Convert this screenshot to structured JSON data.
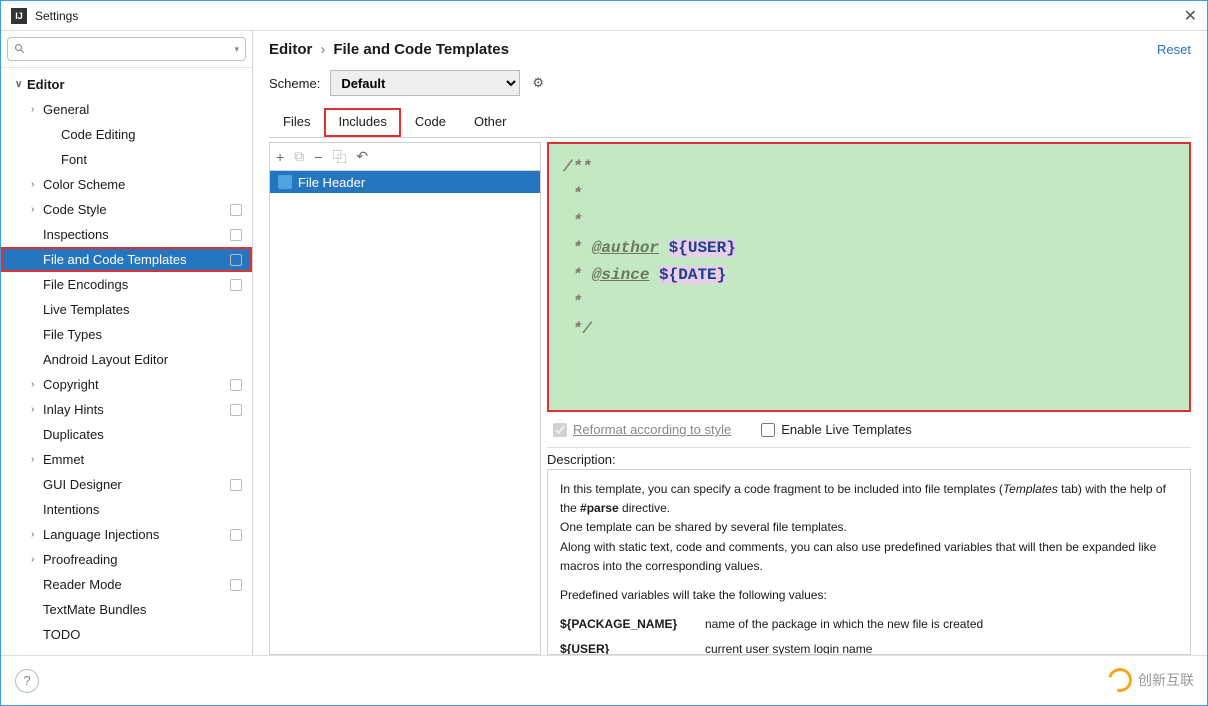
{
  "window": {
    "title": "Settings",
    "close": "✕"
  },
  "search": {
    "placeholder": ""
  },
  "sidebar": {
    "items": [
      {
        "label": "Editor",
        "level": 0,
        "arrow": "∨",
        "bold": true
      },
      {
        "label": "General",
        "level": 1,
        "arrow": "›"
      },
      {
        "label": "Code Editing",
        "level": 2
      },
      {
        "label": "Font",
        "level": 2
      },
      {
        "label": "Color Scheme",
        "level": 1,
        "arrow": "›"
      },
      {
        "label": "Code Style",
        "level": 1,
        "arrow": "›",
        "badge": true
      },
      {
        "label": "Inspections",
        "level": 1,
        "badge": true
      },
      {
        "label": "File and Code Templates",
        "level": 1,
        "badge": true,
        "selected": true,
        "highlight": true
      },
      {
        "label": "File Encodings",
        "level": 1,
        "badge": true
      },
      {
        "label": "Live Templates",
        "level": 1
      },
      {
        "label": "File Types",
        "level": 1
      },
      {
        "label": "Android Layout Editor",
        "level": 1
      },
      {
        "label": "Copyright",
        "level": 1,
        "arrow": "›",
        "badge": true
      },
      {
        "label": "Inlay Hints",
        "level": 1,
        "arrow": "›",
        "badge": true
      },
      {
        "label": "Duplicates",
        "level": 1
      },
      {
        "label": "Emmet",
        "level": 1,
        "arrow": "›"
      },
      {
        "label": "GUI Designer",
        "level": 1,
        "badge": true
      },
      {
        "label": "Intentions",
        "level": 1
      },
      {
        "label": "Language Injections",
        "level": 1,
        "arrow": "›",
        "badge": true
      },
      {
        "label": "Proofreading",
        "level": 1,
        "arrow": "›"
      },
      {
        "label": "Reader Mode",
        "level": 1,
        "badge": true
      },
      {
        "label": "TextMate Bundles",
        "level": 1
      },
      {
        "label": "TODO",
        "level": 1
      }
    ]
  },
  "breadcrumb": {
    "root": "Editor",
    "sep": "›",
    "current": "File and Code Templates",
    "reset": "Reset"
  },
  "scheme": {
    "label": "Scheme:",
    "value": "Default"
  },
  "tabs": [
    {
      "label": "Files"
    },
    {
      "label": "Includes",
      "active": true,
      "highlight": true
    },
    {
      "label": "Code"
    },
    {
      "label": "Other"
    }
  ],
  "toolbar": {
    "add": "+",
    "copy": "⧉",
    "remove": "−",
    "copy2": "⿻",
    "undo": "↶"
  },
  "templates": [
    {
      "label": "File Header"
    }
  ],
  "editor": {
    "line1": "/**",
    "line2": " *",
    "line3": " *",
    "line4_prefix": " * ",
    "author_tag": "@author",
    "author_var": "${USER}",
    "line5_prefix": " * ",
    "since_tag": "@since",
    "since_var": "${DATE}",
    "line6": " *",
    "line7": " */"
  },
  "options": {
    "reformat": "Reformat according to style",
    "reformat_checked": true,
    "live": "Enable Live Templates",
    "live_checked": false
  },
  "description": {
    "label": "Description:",
    "p1_a": "In this template, you can specify a code fragment to be included into file templates (",
    "p1_i": "Templates",
    "p1_b": " tab) with the help of the ",
    "p1_bold": "#parse",
    "p1_c": " directive.",
    "p2": "One template can be shared by several file templates.",
    "p3": "Along with static text, code and comments, you can also use predefined variables that will then be expanded like macros into the corresponding values.",
    "p4": "Predefined variables will take the following values:",
    "vars": [
      {
        "name": "${PACKAGE_NAME}",
        "desc": "name of the package in which the new file is created"
      },
      {
        "name": "${USER}",
        "desc": "current user system login name"
      }
    ]
  },
  "watermark": "创新互联"
}
